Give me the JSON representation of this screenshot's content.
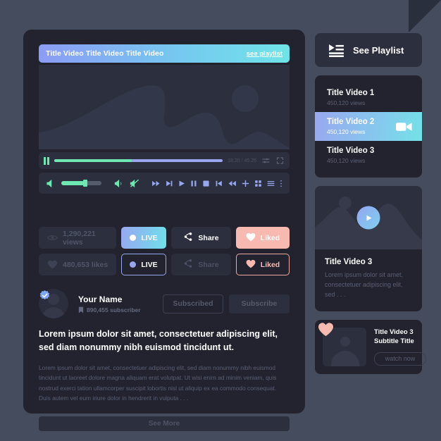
{
  "theme": {
    "page_bg": "#454c5e",
    "panel_bg": "#22232e",
    "surface": "#2c2f3d",
    "accent_green": "#6ee7b0",
    "accent_blue": "#98a8f0",
    "accent_cyan": "#6fe3e8",
    "accent_pink": "#f8b9b0",
    "text_muted": "#5a5f74"
  },
  "player": {
    "title": "Title Video Title Video Title Video",
    "see_playlist_link": "see playlist",
    "time": "18.20 / 45.26",
    "progress_percent": 46,
    "volume_percent": 58,
    "icons": {
      "pause_small": "pause-icon",
      "settings_sliders": "settings-sliders-icon",
      "fullscreen": "fullscreen-icon",
      "volume_low": "volume-low-icon",
      "volume_high": "volume-high-icon",
      "volume_mute": "volume-mute-icon",
      "fast_forward": "fast-forward-icon",
      "skip_next": "skip-next-icon",
      "play": "play-icon",
      "pause": "pause-icon",
      "stop": "stop-icon",
      "skip_previous": "skip-previous-icon",
      "rewind": "rewind-icon",
      "add": "plus-icon",
      "grid": "grid-icon",
      "list": "list-icon",
      "more": "more-vertical-icon"
    }
  },
  "stats": {
    "row1": {
      "count_label": "1,290,221 views",
      "count_icon": "eye-icon",
      "live_label": "LIVE",
      "share_label": "Share",
      "share_icon": "share-icon",
      "liked_label": "Liked",
      "liked_icon": "heart-icon"
    },
    "row2": {
      "count_label": "480,653 likes",
      "count_icon": "heart-icon",
      "live_label": "LIVE",
      "share_label": "Share",
      "share_icon": "share-icon",
      "liked_label": "Liked",
      "liked_icon": "heart-icon"
    }
  },
  "profile": {
    "name": "Your Name",
    "subscribers": "890,455 subscriber",
    "subscriber_icon": "bookmark-icon",
    "verified_icon": "verified-badge-icon",
    "avatar_icon": "avatar-icon",
    "subscribed_label": "Subscribed",
    "subscribe_label": "Subscribe"
  },
  "article": {
    "headline": "Lorem ipsum dolor sit amet, consectetuer adipiscing elit, sed diam nonummy nibh euismod tincidunt ut.",
    "body": "Lorem ipsum dolor sit amet, consectetuer adipiscing elit, sed diam nonummy nibh euismod tincidunt ut laoreet dolore magna aliquam erat volutpat. Ut wisi enim ad minim veniam, quis nostrud exerci tation ullamcorper suscipit lobortis nisl ut aliquip ex ea commodo consequat. Duis autem vel eum iriure dolor in hendrerit in vulputa . . .",
    "see_more_label": "See More"
  },
  "sidebar": {
    "see_playlist": {
      "label": "See Playlist",
      "icon": "playlist-play-icon"
    },
    "playlist_items": [
      {
        "title": "Title Video 1",
        "views": "450,120 views",
        "active": false
      },
      {
        "title": "Title Video 2",
        "views": "450,120 views",
        "active": true,
        "icon": "video-camera-icon"
      },
      {
        "title": "Title Video 3",
        "views": "450,120 views",
        "active": false
      }
    ],
    "video_card": {
      "play_icon": "play-icon",
      "title": "Title Video 3",
      "description": "Lorem ipsum dolor sit amet, consectetuer adipiscing elit, sed . . ."
    },
    "bottom_card": {
      "heart_icon": "heart-icon",
      "thumb_icon": "avatar-icon",
      "title": "Title Video 3 Subtitle Title",
      "watch_label": "watch now"
    }
  }
}
